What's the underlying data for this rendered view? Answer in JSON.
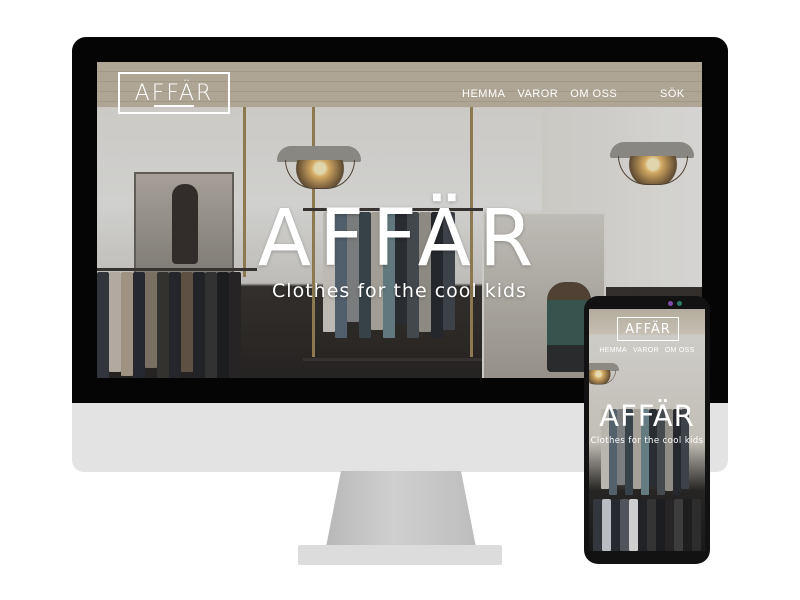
{
  "brand": {
    "logo_text": "AFFÄR",
    "hero_title": "AFFÄR",
    "tagline": "Clothes for the cool kids"
  },
  "desktop_nav": {
    "items": [
      "HEMMA",
      "VAROR",
      "OM OSS"
    ],
    "search_label": "SÖK"
  },
  "mobile": {
    "logo_text": "AFFÄR",
    "nav_items": [
      "HEMMA",
      "VAROR",
      "OM OSS"
    ],
    "hero_title": "AFFÄR",
    "tagline": "Clothes for the cool kids"
  },
  "colors": {
    "bezel": "#050505",
    "monitor_chin": "#e3e3e3",
    "text_on_hero": "#ffffff"
  }
}
